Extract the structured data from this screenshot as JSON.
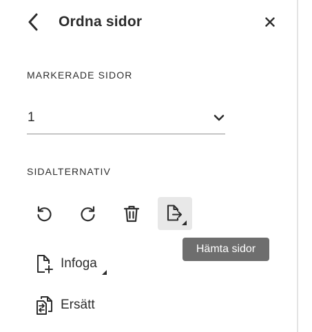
{
  "header": {
    "title": "Ordna sidor",
    "back_icon": "chevron-left-icon",
    "close_icon": "close-icon"
  },
  "selected_pages": {
    "label": "MARKERADE SIDOR",
    "value": "1",
    "dropdown_icon": "chevron-down-icon"
  },
  "page_options": {
    "label": "SIDALTERNATIV",
    "tools": [
      {
        "name": "rotate-left",
        "icon": "rotate-counterclockwise-icon"
      },
      {
        "name": "rotate-right",
        "icon": "rotate-clockwise-icon"
      },
      {
        "name": "delete",
        "icon": "trash-icon"
      },
      {
        "name": "extract",
        "icon": "file-export-icon",
        "active": true
      }
    ],
    "tooltip": "Hämta sidor"
  },
  "actions": {
    "insert_label": "Infoga",
    "insert_icon": "file-plus-icon",
    "replace_label": "Ersätt",
    "replace_icon": "file-replace-icon"
  },
  "colors": {
    "text": "#2c2c2c",
    "tooltip_bg": "#6e6e6e",
    "active_tool_bg": "#e8e8e8",
    "divider": "#e4e4e4",
    "underline": "#8e8e8e"
  }
}
